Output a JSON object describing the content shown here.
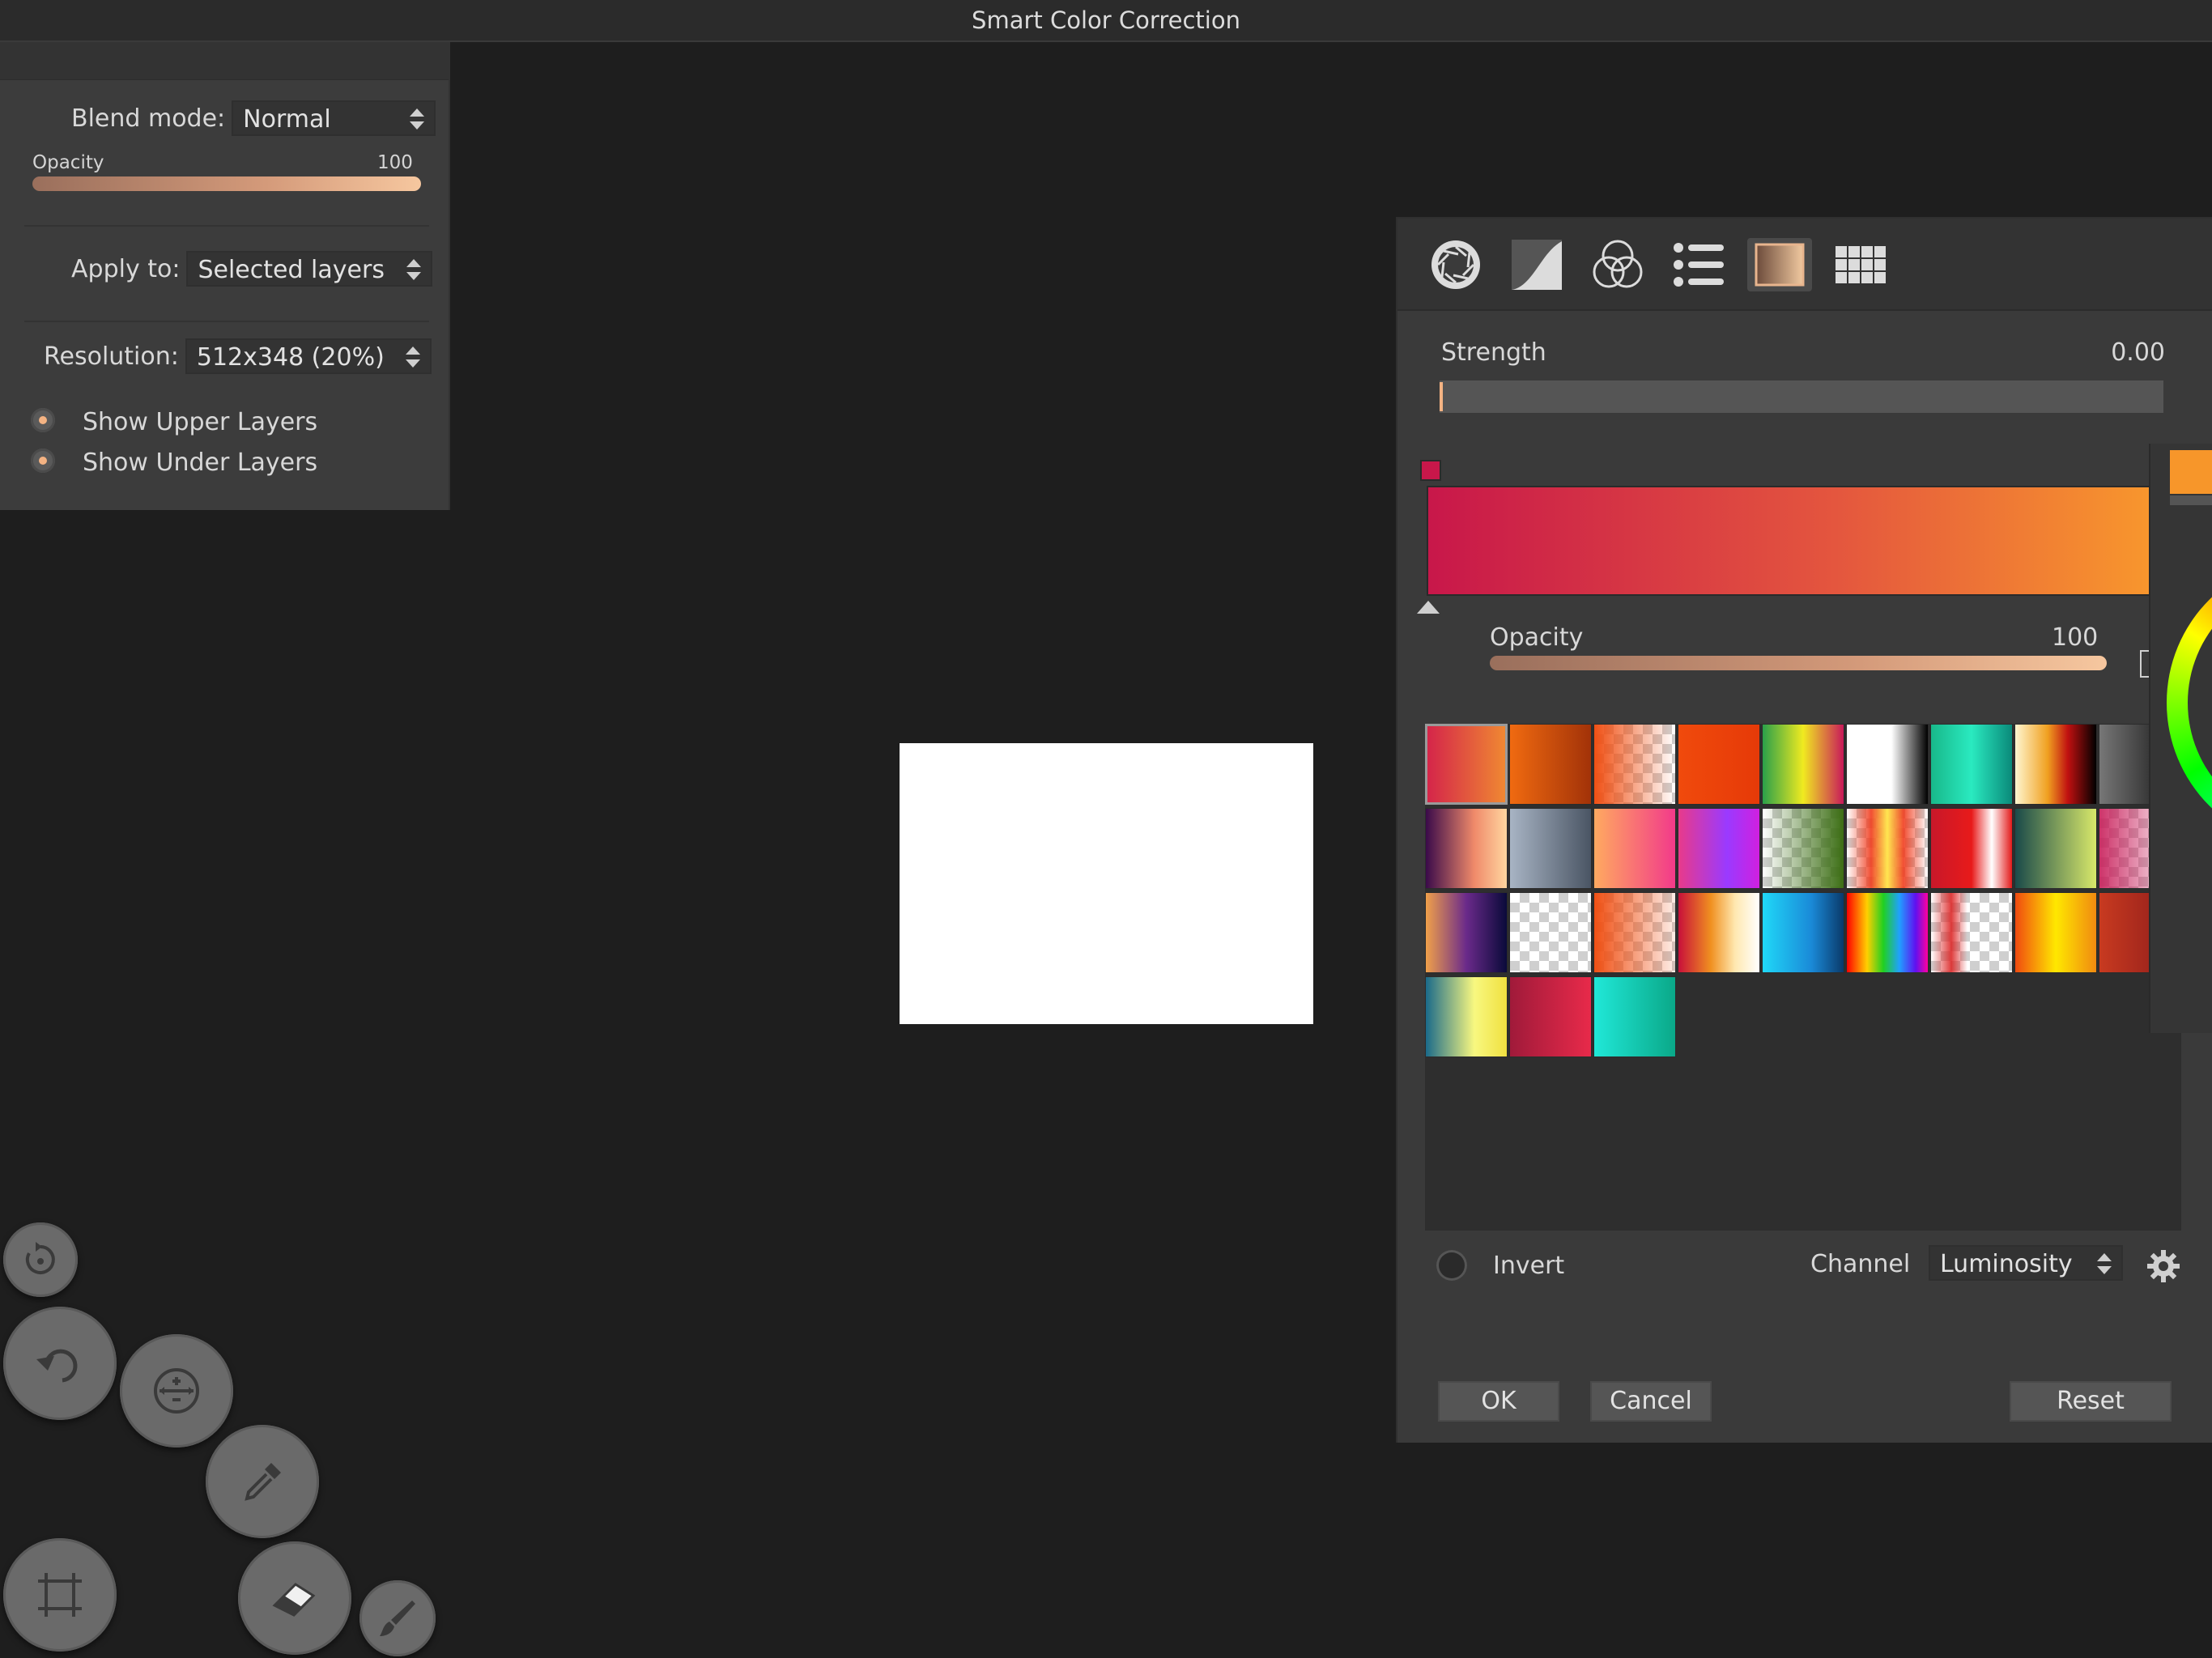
{
  "window": {
    "title": "Smart Color Correction"
  },
  "left_panel": {
    "blend_mode": {
      "label": "Blend mode:",
      "value": "Normal"
    },
    "opacity": {
      "label": "Opacity",
      "value": "100"
    },
    "apply_to": {
      "label": "Apply to:",
      "value": "Selected layers"
    },
    "resolution": {
      "label": "Resolution:",
      "value": "512x348 (20%)"
    },
    "options": [
      {
        "label": "Show Upper Layers",
        "checked": true
      },
      {
        "label": "Show Under Layers",
        "checked": true
      }
    ]
  },
  "tools": [
    "redo-icon",
    "undo-icon",
    "transform-icon",
    "eyedropper-icon",
    "crop-icon",
    "eraser-icon",
    "brush-icon"
  ],
  "dialog": {
    "tabs": [
      "aperture-icon",
      "curves-icon",
      "color-balance-icon",
      "list-icon",
      "gradient-map-icon",
      "grid-icon"
    ],
    "active_tab": "gradient-map-icon",
    "strength": {
      "label": "Strength",
      "value": "0.00"
    },
    "gradient": {
      "start_color": "#c8174a",
      "end_color": "#f99a2c"
    },
    "opacity": {
      "label": "Opacity",
      "value": "100"
    },
    "invert": {
      "label": "Invert",
      "checked": false
    },
    "channel": {
      "label": "Channel",
      "value": "Luminosity"
    },
    "buttons": {
      "ok": "OK",
      "cancel": "Cancel",
      "reset": "Reset"
    }
  },
  "accent_color": "#f4b383"
}
